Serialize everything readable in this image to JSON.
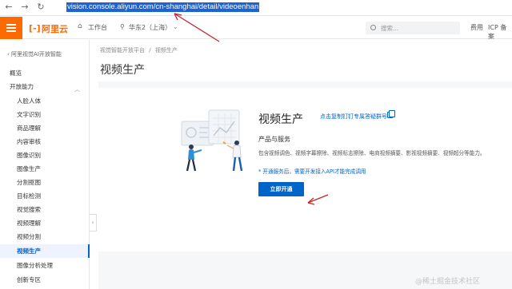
{
  "browser": {
    "back": "←",
    "forward": "→",
    "reload": "↻",
    "url": "vision.console.aliyun.com/cn-shanghai/detail/videoenhan"
  },
  "header": {
    "logo_text": "阿里云",
    "workbench": "工作台",
    "region": "华东2（上海）",
    "search_placeholder": "搜索...",
    "fee": "费用",
    "icp": "ICP 备案"
  },
  "sidebar": {
    "back": "阿里视觉AI开放智能",
    "items": [
      {
        "label": "概览",
        "level": 1
      },
      {
        "label": "开放能力",
        "level": 1
      },
      {
        "label": "人脸人体",
        "level": 2
      },
      {
        "label": "文字识别",
        "level": 2
      },
      {
        "label": "商品理解",
        "level": 2
      },
      {
        "label": "内容审核",
        "level": 2
      },
      {
        "label": "图像识别",
        "level": 2
      },
      {
        "label": "图像生产",
        "level": 2
      },
      {
        "label": "分割抠图",
        "level": 2
      },
      {
        "label": "目标检测",
        "level": 2
      },
      {
        "label": "视觉搜索",
        "level": 2
      },
      {
        "label": "视频理解",
        "level": 2
      },
      {
        "label": "视频分割",
        "level": 2
      },
      {
        "label": "视频生产",
        "level": 2,
        "active": true
      },
      {
        "label": "图像分析处理",
        "level": 2
      },
      {
        "label": "创新专区",
        "level": 2
      }
    ]
  },
  "main": {
    "breadcrumb_root": "视觉智能开放平台",
    "breadcrumb_sep": "/",
    "breadcrumb_current": "视频生产",
    "page_title": "视频生产",
    "product_title": "视频生产",
    "dingtalk_link": "点击复制钉钉专属答疑群号",
    "section_title": "产品与服务",
    "description": "包含视频调色、视频字幕擦除、视频标志擦除、电商视频摘要、影视视频摘要、视频超分等能力。",
    "note": "* 开通服务后，需要开发接入API才能完成调用",
    "activate_button": "立即开通"
  },
  "watermark": "@稀土掘金技术社区",
  "colors": {
    "accent": "#ff6a00",
    "primary": "#0064c8",
    "arrow": "#c0272d"
  }
}
